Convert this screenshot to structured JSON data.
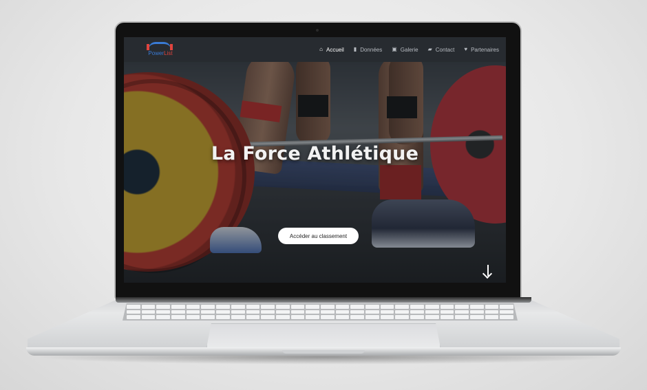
{
  "brand": {
    "word1": "Power",
    "word2": "List",
    "icon": "barbell-icon"
  },
  "nav": {
    "items": [
      {
        "label": "Accueil",
        "icon": "home-icon",
        "active": true
      },
      {
        "label": "Données",
        "icon": "bar-chart-icon",
        "active": false
      },
      {
        "label": "Galerie",
        "icon": "gallery-icon",
        "active": false
      },
      {
        "label": "Contact",
        "icon": "chat-icon",
        "active": false
      },
      {
        "label": "Partenaires",
        "icon": "handshake-icon",
        "active": false
      }
    ]
  },
  "hero": {
    "title": "La Force Athlétique",
    "cta_label": "Accéder au classement",
    "scroll_icon": "arrow-down-icon"
  },
  "colors": {
    "brand_blue": "#3a7bd5",
    "brand_red": "#e0443e",
    "nav_bg": "#272b30"
  }
}
